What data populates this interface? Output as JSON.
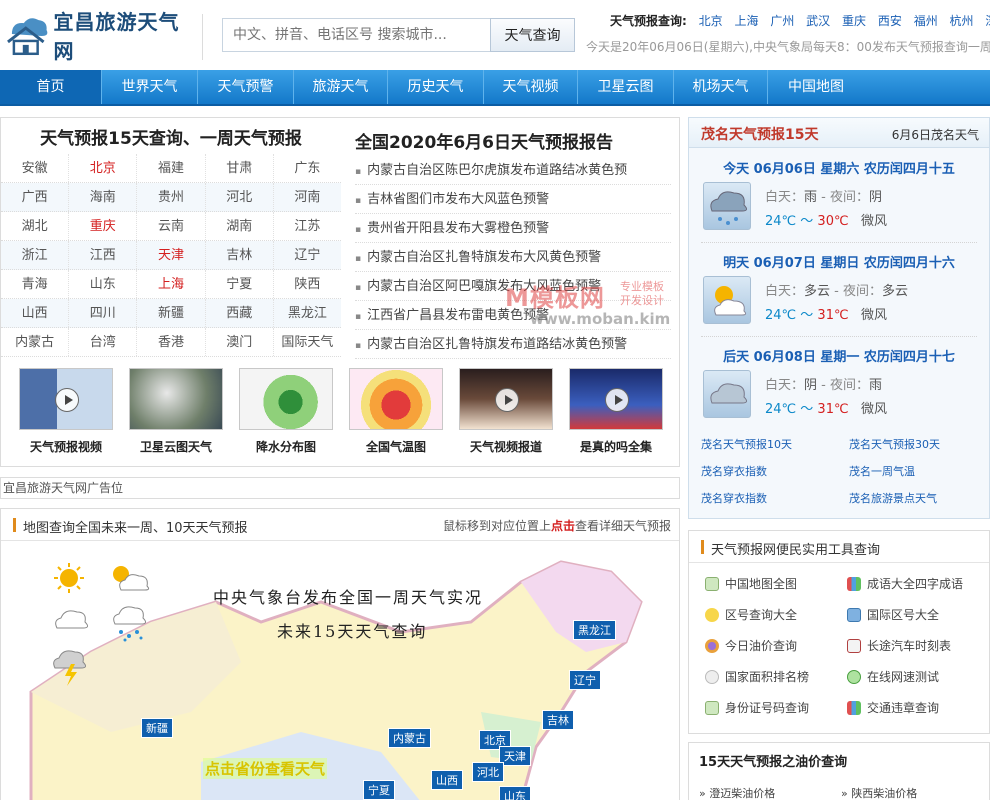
{
  "site": {
    "logo_text": "宜昌旅游天气网"
  },
  "search": {
    "placeholder": "中文、拼音、电话区号 搜索城市...",
    "button": "天气查询"
  },
  "hot": {
    "label": "天气预报查询:",
    "cities": [
      "北京",
      "上海",
      "广州",
      "武汉",
      "重庆",
      "西安",
      "福州",
      "杭州",
      "深圳"
    ]
  },
  "notice": "今天是20年06月06日(星期六),中央气象局每天8：00发布天气预报查询一周",
  "nav": [
    "首页",
    "世界天气",
    "天气预警",
    "旅游天气",
    "历史天气",
    "天气视频",
    "卫星云图",
    "机场天气",
    "中国地图"
  ],
  "provinces": {
    "title": "天气预报15天查询、一周天气预报",
    "rows": [
      [
        "安徽",
        "北京",
        "福建",
        "甘肃",
        "广东"
      ],
      [
        "广西",
        "海南",
        "贵州",
        "河北",
        "河南"
      ],
      [
        "湖北",
        "重庆",
        "云南",
        "湖南",
        "江苏"
      ],
      [
        "浙江",
        "江西",
        "天津",
        "吉林",
        "辽宁"
      ],
      [
        "青海",
        "山东",
        "上海",
        "宁夏",
        "陕西"
      ],
      [
        "山西",
        "四川",
        "新疆",
        "西藏",
        "黑龙江"
      ],
      [
        "内蒙古",
        "台湾",
        "香港",
        "澳门",
        "国际天气"
      ]
    ],
    "highlighted": [
      "北京",
      "重庆",
      "天津",
      "上海"
    ]
  },
  "report": {
    "title": "全国2020年6月6日天气预报报告",
    "items": [
      "内蒙古自治区陈巴尔虎旗发布道路结冰黄色预",
      "吉林省图们市发布大风蓝色预警",
      "贵州省开阳县发布大雾橙色预警",
      "内蒙古自治区扎鲁特旗发布大风黄色预警",
      "内蒙古自治区阿巴嘎旗发布大风蓝色预警",
      "江西省广昌县发布雷电黄色预警",
      "内蒙古自治区扎鲁特旗发布道路结冰黄色预警"
    ]
  },
  "thumbs": [
    "天气预报视频",
    "卫星云图天气",
    "降水分布图",
    "全国气温图",
    "天气视频报道",
    "是真的吗全集"
  ],
  "ad": "宜昌旅游天气网广告位",
  "map": {
    "title": "地图查询全国未来一周、10天天气预报",
    "hint_pre": "鼠标移到对应位置上",
    "hint_click": "点击",
    "hint_post": "查看详细天气预报",
    "line1": "中央气象台发布全国一周天气实况",
    "line2": "未来15天天气查询",
    "click_text": "点击省份查看天气",
    "provinces": [
      "黑龙江",
      "辽宁",
      "吉林",
      "新疆",
      "内蒙古",
      "北京",
      "天津",
      "河北",
      "山西",
      "宁夏",
      "山东"
    ]
  },
  "forecast": {
    "title": "茂名天气预报15天",
    "date": "6月6日茂名天气",
    "days": [
      {
        "head": "今天 06月06日 星期六 农历闰四月十五",
        "day": "雨",
        "night": "阴",
        "low": "24℃",
        "high": "30℃",
        "wind": "微风"
      },
      {
        "head": "明天 06月07日 星期日 农历闰四月十六",
        "day": "多云",
        "night": "多云",
        "low": "24℃",
        "high": "31℃",
        "wind": "微风"
      },
      {
        "head": "后天 06月08日 星期一 农历闰四月十七",
        "day": "阴",
        "night": "雨",
        "low": "24℃",
        "high": "31℃",
        "wind": "微风"
      }
    ],
    "day_label": "白天：",
    "night_label": " - 夜间：",
    "tilde": " ～ ",
    "links": [
      "茂名天气预报10天",
      "茂名天气预报30天",
      "茂名穿衣指数",
      "茂名一周气温",
      "茂名穿衣指数",
      "茂名旅游景点天气"
    ]
  },
  "tools": {
    "title": "天气预报网便民实用工具查询",
    "items": [
      "中国地图全图",
      "成语大全四字成语",
      "区号查询大全",
      "国际区号大全",
      "今日油价查询",
      "长途汽车时刻表",
      "国家面积排名榜",
      "在线网速测试",
      "身份证号码查询",
      "交通违章查询"
    ]
  },
  "oil": {
    "title": "15天天气预报之油价查询",
    "items": [
      "澄迈柴油价格",
      "陕西柴油价格"
    ]
  },
  "watermark": {
    "main": "M模板网",
    "side1": "专业模板",
    "side2": "开发设计",
    "url": "www.moban.kim"
  }
}
